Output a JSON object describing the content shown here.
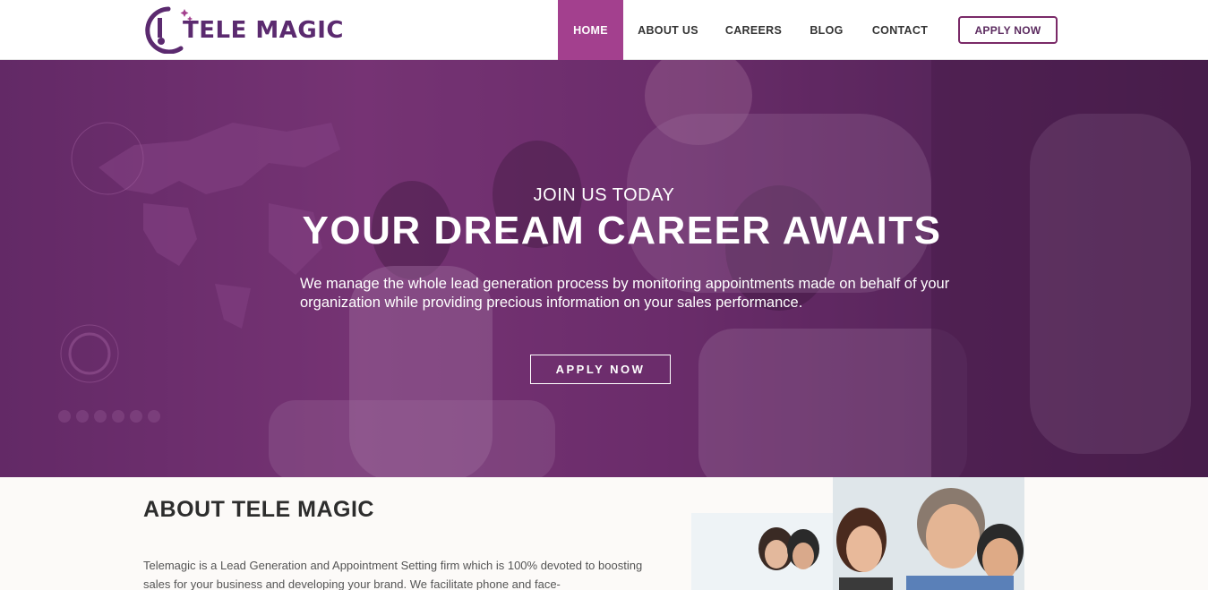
{
  "brand": {
    "name": "TELE MAGIC",
    "color": "#5b2a6f"
  },
  "nav": {
    "items": [
      {
        "label": "HOME",
        "active": true
      },
      {
        "label": "ABOUT US",
        "active": false
      },
      {
        "label": "CAREERS",
        "active": false
      },
      {
        "label": "BLOG",
        "active": false
      },
      {
        "label": "CONTACT",
        "active": false
      }
    ],
    "apply_label": "APPLY NOW",
    "active_color": "#a3408e"
  },
  "hero": {
    "subtitle": "JOIN US TODAY",
    "title": "YOUR DREAM CAREER AWAITS",
    "description": "We manage the whole lead generation process by monitoring appointments made on behalf of your organization while providing precious information on your sales performance.",
    "button_label": "APPLY NOW"
  },
  "about": {
    "title": "ABOUT TELE MAGIC",
    "text": "Telemagic is a Lead Generation and Appointment Setting firm which is 100% devoted to boosting sales for your business and developing your brand. We facilitate phone and face-"
  }
}
